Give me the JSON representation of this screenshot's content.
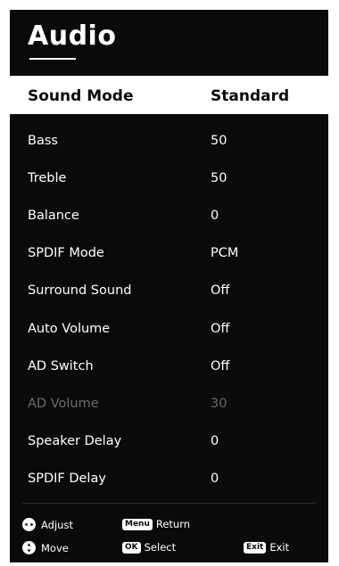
{
  "title": "Audio",
  "selected": {
    "label": "Sound Mode",
    "value": "Standard"
  },
  "items": [
    {
      "label": "Bass",
      "value": "50"
    },
    {
      "label": "Treble",
      "value": "50"
    },
    {
      "label": "Balance",
      "value": "0"
    },
    {
      "label": "SPDIF Mode",
      "value": "PCM"
    },
    {
      "label": "Surround Sound",
      "value": "Off"
    },
    {
      "label": "Auto Volume",
      "value": "Off"
    },
    {
      "label": "AD Switch",
      "value": "Off"
    },
    {
      "label": "AD Volume",
      "value": "30"
    },
    {
      "label": "Speaker Delay",
      "value": "0"
    },
    {
      "label": "SPDIF Delay",
      "value": "0"
    }
  ],
  "footer": {
    "adjust": "Adjust",
    "move": "Move",
    "menu_key": "Menu",
    "return": "Return",
    "ok_key": "OK",
    "select": "Select",
    "exit_key": "Exit",
    "exit": "Exit"
  },
  "colors": {
    "background": "#0a0a0a",
    "highlight": "#ffffff",
    "disabled_text": "#6b6b6b"
  }
}
